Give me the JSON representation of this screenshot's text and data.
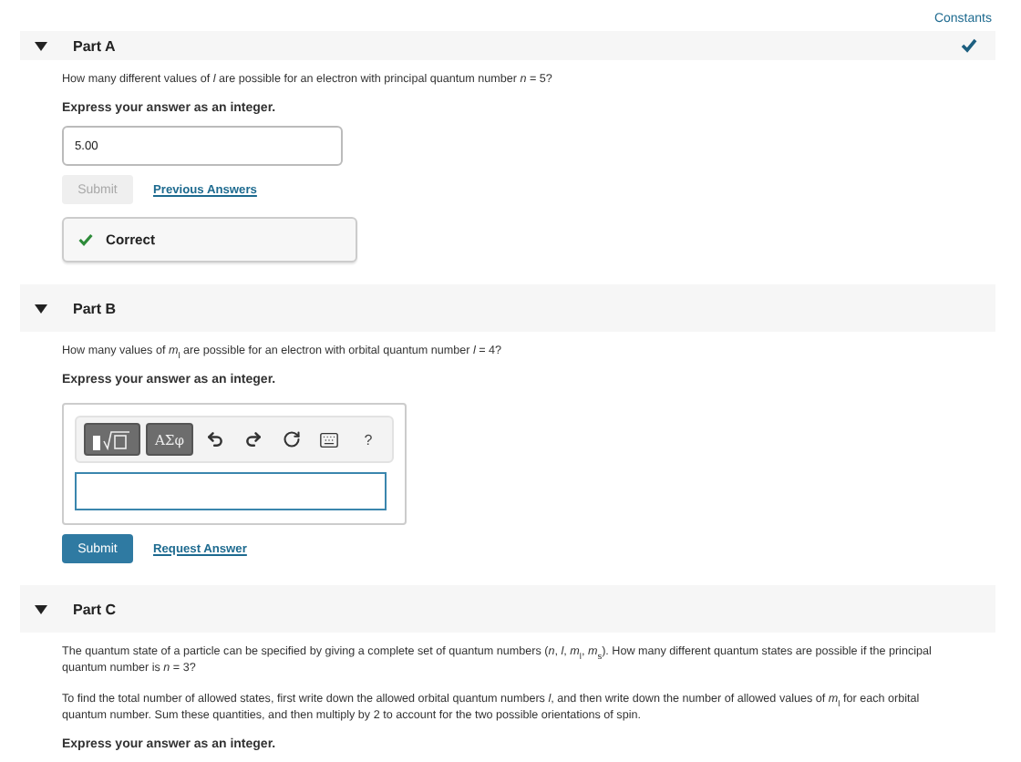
{
  "constants_link": "Constants",
  "parts": [
    {
      "title": "Part A",
      "expanded": true,
      "completed": true,
      "kind": "simple",
      "paragraphs": [
        "How many different values of *l* are possible for an electron with principal quantum number *n* = 5?"
      ],
      "instruction": "Express your answer as an integer.",
      "answer": {
        "value": "5.00"
      },
      "submit": {
        "label": "Submit",
        "disabled": true
      },
      "link": "Previous Answers",
      "feedback": {
        "label": "Correct"
      }
    },
    {
      "title": "Part B",
      "expanded": true,
      "completed": false,
      "kind": "editor",
      "paragraphs": [
        "How many values of *m*$_{l}$ are possible for an electron with orbital quantum number *l* = 4?"
      ],
      "instruction": "Express your answer as an integer.",
      "toolbar": [
        {
          "kind": "templates"
        },
        {
          "kind": "symbols",
          "label": "ΑΣφ"
        },
        {
          "kind": "undo"
        },
        {
          "kind": "redo"
        },
        {
          "kind": "reset"
        },
        {
          "kind": "keyboard"
        },
        {
          "kind": "help",
          "label": "?"
        }
      ],
      "submit": {
        "label": "Submit",
        "disabled": false
      },
      "link": "Request Answer"
    },
    {
      "title": "Part C",
      "expanded": true,
      "completed": false,
      "kind": "text",
      "paragraphs": [
        "The quantum state of a particle can be specified by giving a complete set of quantum numbers (*n*, *l*, *m*$_{l}$, *m*$_{s}$). How many different quantum states are possible if the principal quantum number is *n* = 3?",
        "To find the total number of allowed states, first write down the allowed orbital quantum numbers *l*, and then write down the number of allowed values of *m*$_{l}$ for each orbital quantum number. Sum these quantities, and then multiply by 2 to account for the two possible orientations of spin."
      ],
      "instruction": "Express your answer as an integer."
    }
  ]
}
